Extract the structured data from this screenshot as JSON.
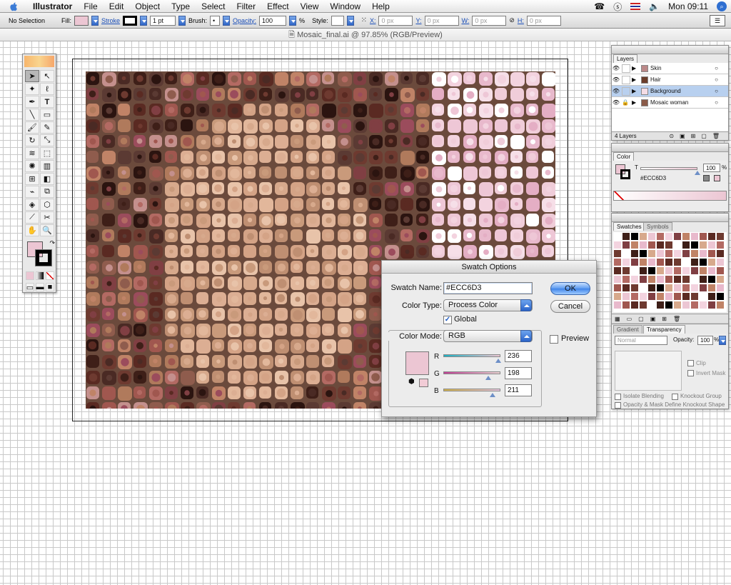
{
  "menubar": {
    "app": "Illustrator",
    "items": [
      "File",
      "Edit",
      "Object",
      "Type",
      "Select",
      "Filter",
      "Effect",
      "View",
      "Window",
      "Help"
    ],
    "clock": "Mon 09:11"
  },
  "control": {
    "selection": "No Selection",
    "fill_label": "Fill:",
    "stroke_label": "Stroke",
    "stroke_weight": "1 pt",
    "brush_label": "Brush:",
    "opacity_label": "Opacity:",
    "opacity_value": "100",
    "opacity_unit": "%",
    "style_label": "Style:",
    "x_label": "X:",
    "x_value": "0 px",
    "y_label": "Y:",
    "y_value": "0 px",
    "w_label": "W:",
    "w_value": "0 px",
    "h_label": "H:",
    "h_value": "0 px",
    "fill_color": "#ECC6D3"
  },
  "document": {
    "title": "Mosaic_final.ai @ 97.85% (RGB/Preview)"
  },
  "layers": {
    "tab": "Layers",
    "items": [
      {
        "name": "Skin",
        "selected": false
      },
      {
        "name": "Hair",
        "selected": false
      },
      {
        "name": "Background",
        "selected": true
      },
      {
        "name": "Mosaic woman",
        "selected": false
      }
    ],
    "count": "4 Layers"
  },
  "color_panel": {
    "tab": "Color",
    "channel": "T",
    "value": "100",
    "unit": "%",
    "hex": "#ECC6D3"
  },
  "swatches_panel": {
    "tab": "Swatches",
    "tab2": "Symbols"
  },
  "transparency_panel": {
    "tab": "Gradient",
    "tab2": "Transparency",
    "mode": "Normal",
    "opacity_label": "Opacity:",
    "opacity_value": "100",
    "opacity_unit": "%",
    "clip": "Clip",
    "invert": "Invert Mask",
    "isolate": "Isolate Blending",
    "knockout": "Knockout Group",
    "opacity_mask": "Opacity & Mask Define Knockout Shape"
  },
  "dialog": {
    "title": "Swatch Options",
    "name_label": "Swatch Name:",
    "name_value": "#ECC6D3",
    "type_label": "Color Type:",
    "type_value": "Process Color",
    "global_label": "Global",
    "global_checked": true,
    "mode_label": "Color Mode:",
    "mode_value": "RGB",
    "ok": "OK",
    "cancel": "Cancel",
    "preview": "Preview",
    "r_label": "R",
    "r_value": "236",
    "g_label": "G",
    "g_value": "198",
    "b_label": "B",
    "b_value": "211",
    "color": "#ECC6D3"
  }
}
